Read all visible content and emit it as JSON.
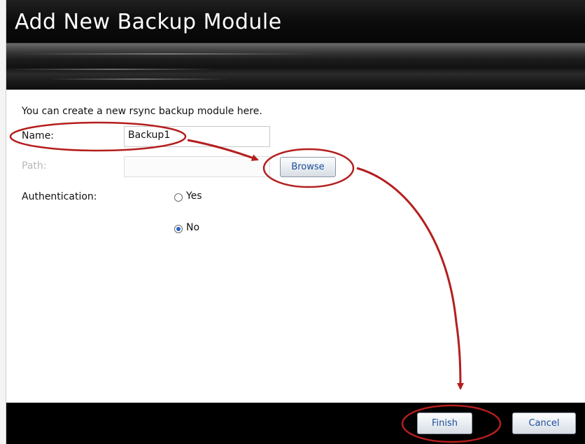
{
  "dialog": {
    "title": "Add New Backup Module",
    "intro": "You can create a new rsync backup module here."
  },
  "form": {
    "name_label": "Name:",
    "name_value": "Backup1",
    "path_label": "Path:",
    "path_value": "",
    "browse_label": "Browse",
    "auth_label": "Authentication:",
    "auth_options": [
      {
        "label": "Yes",
        "checked": false
      },
      {
        "label": "No",
        "checked": true
      }
    ]
  },
  "footer": {
    "finish_label": "Finish",
    "cancel_label": "Cancel"
  },
  "colors": {
    "annotation": "#b41e1e",
    "button_text": "#1d4d9a",
    "radio_selected": "#2a62c9"
  }
}
